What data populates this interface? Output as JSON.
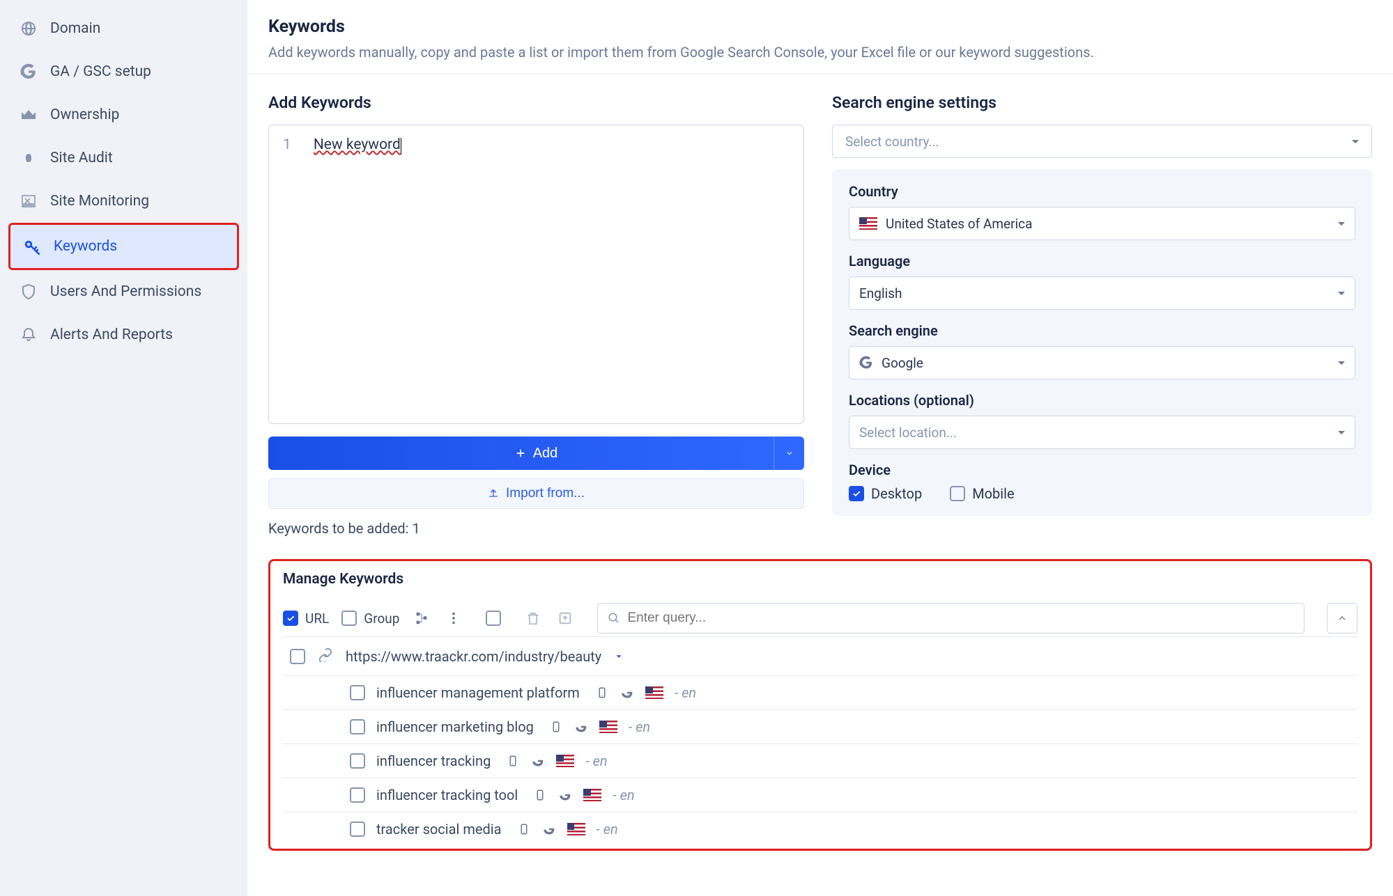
{
  "sidebar": {
    "items": [
      {
        "label": "Domain"
      },
      {
        "label": "GA / GSC setup"
      },
      {
        "label": "Ownership"
      },
      {
        "label": "Site Audit"
      },
      {
        "label": "Site Monitoring"
      },
      {
        "label": "Keywords"
      },
      {
        "label": "Users And Permissions"
      },
      {
        "label": "Alerts And Reports"
      }
    ]
  },
  "header": {
    "title": "Keywords",
    "subtitle": "Add keywords manually, copy and paste a list or import them from Google Search Console, your Excel file or our keyword suggestions."
  },
  "add": {
    "title": "Add Keywords",
    "line_no": "1",
    "editor_text": "New keyword",
    "add_label": "Add",
    "import_label": "Import from...",
    "count_label": "Keywords to be added: 1"
  },
  "settings": {
    "title": "Search engine settings",
    "country_placeholder": "Select country...",
    "country_label": "Country",
    "country_value": "United States of America",
    "language_label": "Language",
    "language_value": "English",
    "engine_label": "Search engine",
    "engine_value": "Google",
    "locations_label": "Locations (optional)",
    "locations_placeholder": "Select location...",
    "device_label": "Device",
    "desktop": "Desktop",
    "mobile": "Mobile"
  },
  "manage": {
    "title": "Manage Keywords",
    "url_label": "URL",
    "group_label": "Group",
    "search_placeholder": "Enter query...",
    "url_value": "https://www.traackr.com/industry/beauty",
    "rows": [
      {
        "kw": "influencer management platform",
        "lang": "- en"
      },
      {
        "kw": "influencer marketing blog",
        "lang": "- en"
      },
      {
        "kw": "influencer tracking",
        "lang": "- en"
      },
      {
        "kw": "influencer tracking tool",
        "lang": "- en"
      },
      {
        "kw": "tracker social media",
        "lang": "- en"
      }
    ]
  }
}
